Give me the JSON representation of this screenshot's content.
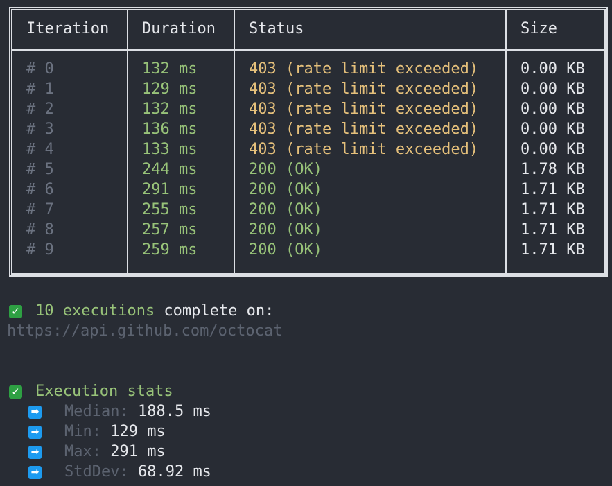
{
  "table": {
    "headers": [
      "Iteration",
      "Duration",
      "Status",
      "Size"
    ],
    "rows": [
      {
        "iteration": "# 0",
        "duration": "132 ms",
        "status": "403 (rate limit exceeded)",
        "size": "0.00 KB",
        "kind": "warn"
      },
      {
        "iteration": "# 1",
        "duration": "129 ms",
        "status": "403 (rate limit exceeded)",
        "size": "0.00 KB",
        "kind": "warn"
      },
      {
        "iteration": "# 2",
        "duration": "132 ms",
        "status": "403 (rate limit exceeded)",
        "size": "0.00 KB",
        "kind": "warn"
      },
      {
        "iteration": "# 3",
        "duration": "136 ms",
        "status": "403 (rate limit exceeded)",
        "size": "0.00 KB",
        "kind": "warn"
      },
      {
        "iteration": "# 4",
        "duration": "133 ms",
        "status": "403 (rate limit exceeded)",
        "size": "0.00 KB",
        "kind": "warn"
      },
      {
        "iteration": "# 5",
        "duration": "244 ms",
        "status": "200 (OK)",
        "size": "1.78 KB",
        "kind": "ok"
      },
      {
        "iteration": "# 6",
        "duration": "291 ms",
        "status": "200 (OK)",
        "size": "1.71 KB",
        "kind": "ok"
      },
      {
        "iteration": "# 7",
        "duration": "255 ms",
        "status": "200 (OK)",
        "size": "1.71 KB",
        "kind": "ok"
      },
      {
        "iteration": "# 8",
        "duration": "257 ms",
        "status": "200 (OK)",
        "size": "1.71 KB",
        "kind": "ok"
      },
      {
        "iteration": "# 9",
        "duration": "259 ms",
        "status": "200 (OK)",
        "size": "1.71 KB",
        "kind": "ok"
      }
    ]
  },
  "summary": {
    "icon": "check-icon",
    "count_text": "10 executions",
    "rest_text": " complete on:",
    "url": "https://api.github.com/octocat"
  },
  "stats": {
    "icon": "check-icon",
    "title": "Execution stats",
    "items": [
      {
        "icon": "arrow-right-icon",
        "label": "Median:",
        "value": "188.5 ms"
      },
      {
        "icon": "arrow-right-icon",
        "label": "Min:",
        "value": "129 ms"
      },
      {
        "icon": "arrow-right-icon",
        "label": "Max:",
        "value": "291 ms"
      },
      {
        "icon": "arrow-right-icon",
        "label": "StdDev:",
        "value": "68.92 ms"
      }
    ]
  },
  "colors": {
    "background": "#282c34",
    "duration": "#98c379",
    "warning": "#e5c07b",
    "ok": "#98c379",
    "muted": "#6b7280",
    "check": "#2ea043",
    "arrow": "#1d9bf0"
  }
}
